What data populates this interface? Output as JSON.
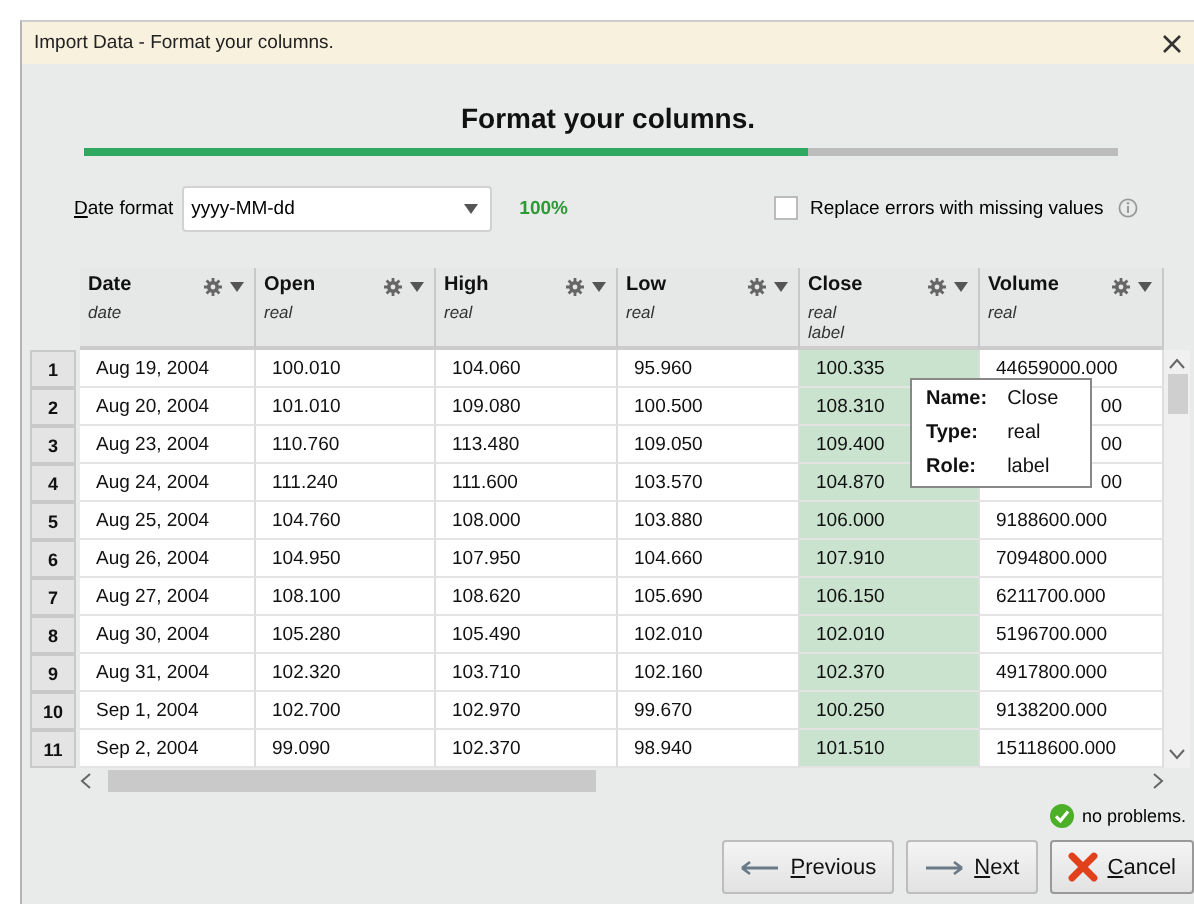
{
  "window": {
    "title": "Import Data - Format your columns."
  },
  "heading": "Format your columns.",
  "progress": {
    "level": 0.7
  },
  "date_format": {
    "label": "Date format",
    "value": "yyyy-MM-dd"
  },
  "parse_rate": "100%",
  "replace_errors": {
    "label": "Replace errors with missing values",
    "checked": false
  },
  "table": {
    "columns": [
      {
        "name": "Date",
        "type": "date"
      },
      {
        "name": "Open",
        "type": "real"
      },
      {
        "name": "High",
        "type": "real"
      },
      {
        "name": "Low",
        "type": "real"
      },
      {
        "name": "Close",
        "type": "real",
        "role": "label"
      },
      {
        "name": "Volume",
        "type": "real"
      }
    ],
    "rows": [
      {
        "number": "1",
        "cells": [
          "Aug 19, 2004",
          "100.010",
          "104.060",
          "95.960",
          "100.335",
          "44659000.000"
        ]
      },
      {
        "number": "2",
        "cells": [
          "Aug 20, 2004",
          "101.010",
          "109.080",
          "100.500",
          "108.310",
          "00"
        ]
      },
      {
        "number": "3",
        "cells": [
          "Aug 23, 2004",
          "110.760",
          "113.480",
          "109.050",
          "109.400",
          "00"
        ]
      },
      {
        "number": "4",
        "cells": [
          "Aug 24, 2004",
          "111.240",
          "111.600",
          "103.570",
          "104.870",
          "00"
        ]
      },
      {
        "number": "5",
        "cells": [
          "Aug 25, 2004",
          "104.760",
          "108.000",
          "103.880",
          "106.000",
          "9188600.000"
        ]
      },
      {
        "number": "6",
        "cells": [
          "Aug 26, 2004",
          "104.950",
          "107.950",
          "104.660",
          "107.910",
          "7094800.000"
        ]
      },
      {
        "number": "7",
        "cells": [
          "Aug 27, 2004",
          "108.100",
          "108.620",
          "105.690",
          "106.150",
          "6211700.000"
        ]
      },
      {
        "number": "8",
        "cells": [
          "Aug 30, 2004",
          "105.280",
          "105.490",
          "102.010",
          "102.010",
          "5196700.000"
        ]
      },
      {
        "number": "9",
        "cells": [
          "Aug 31, 2004",
          "102.320",
          "103.710",
          "102.160",
          "102.370",
          "4917800.000"
        ]
      },
      {
        "number": "10",
        "cells": [
          "Sep 1, 2004",
          "102.700",
          "102.970",
          "99.670",
          "100.250",
          "9138200.000"
        ]
      },
      {
        "number": "11",
        "cells": [
          "Sep 2, 2004",
          "99.090",
          "102.370",
          "98.940",
          "101.510",
          "15118600.000"
        ]
      }
    ]
  },
  "tooltip": [
    {
      "key": "Name:",
      "value": "Close"
    },
    {
      "key": "Type:",
      "value": "real"
    },
    {
      "key": "Role:",
      "value": "label"
    }
  ],
  "status": "no problems.",
  "buttons": [
    {
      "label": "Previous",
      "kind": "previous"
    },
    {
      "label": "Next",
      "kind": "next"
    },
    {
      "label": "Cancel",
      "kind": "cancel"
    }
  ]
}
